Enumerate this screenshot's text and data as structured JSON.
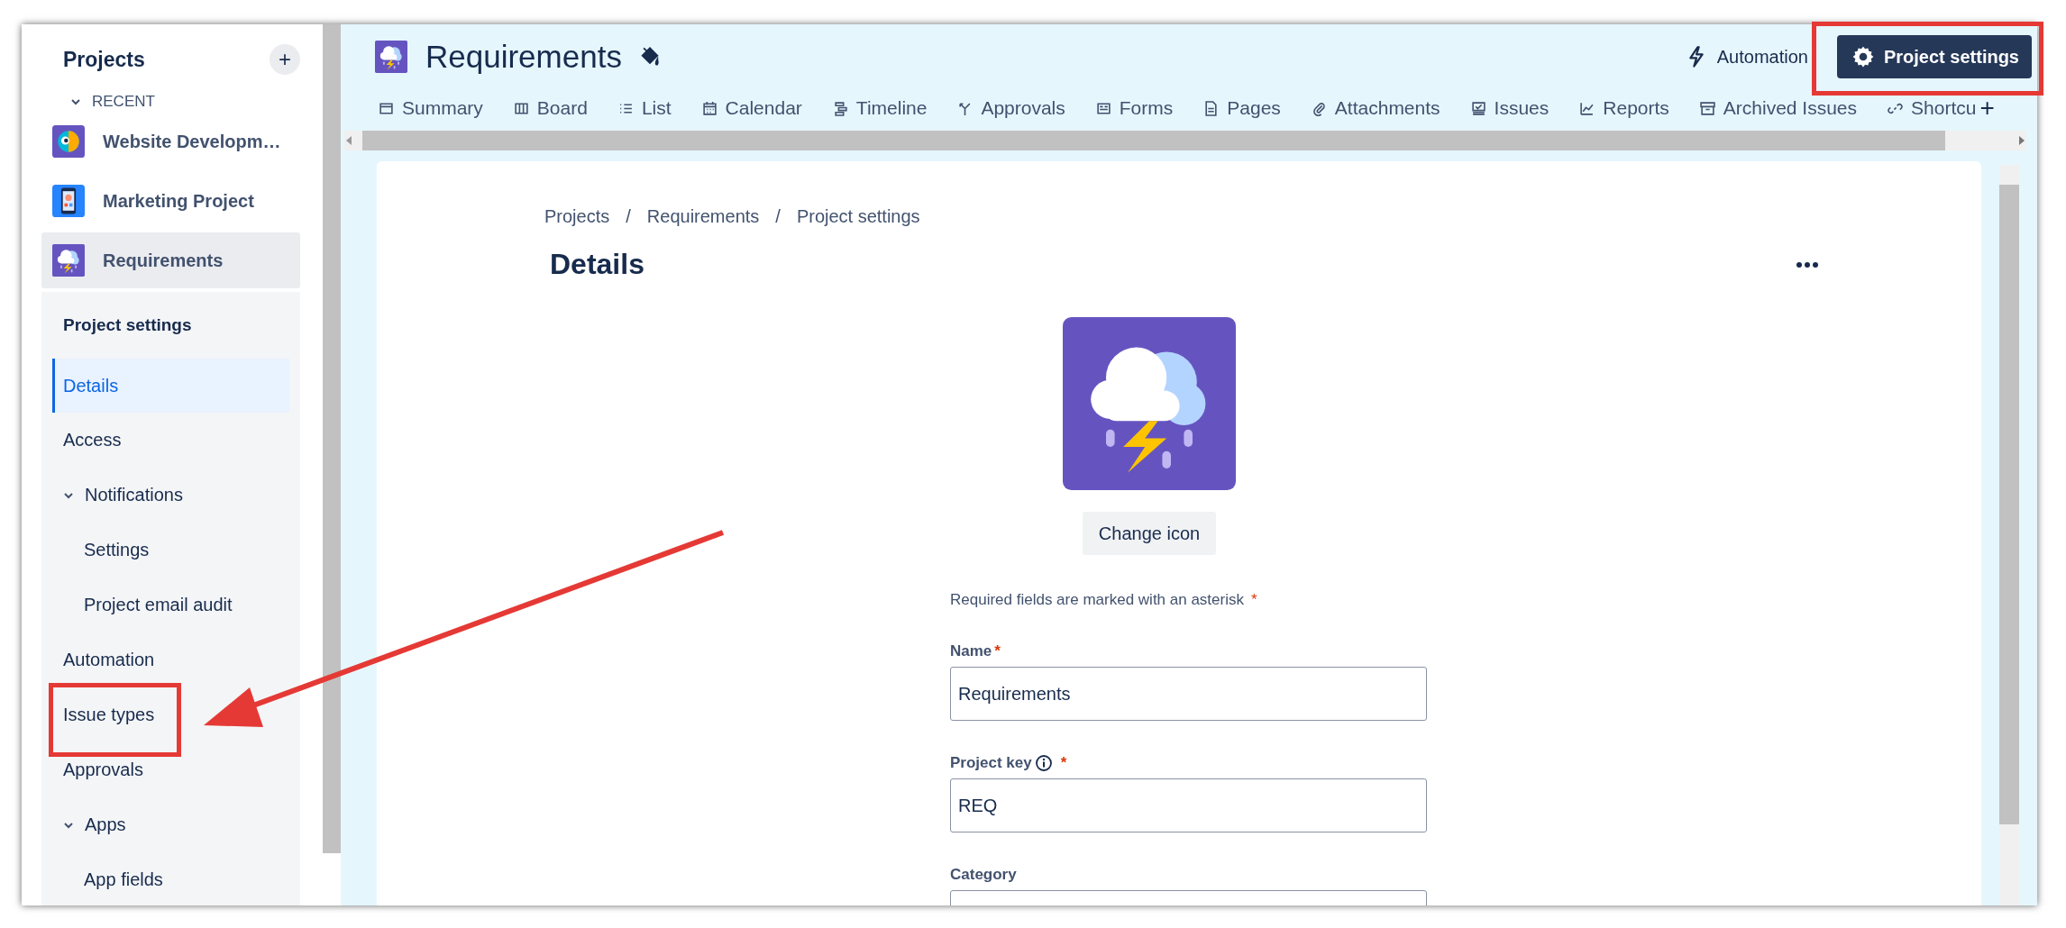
{
  "sidebar": {
    "title": "Projects",
    "add_button": "+",
    "section": "RECENT",
    "section_expanded": true,
    "projects": [
      {
        "name": "Website Developm…",
        "kind": "bird",
        "selected": false
      },
      {
        "name": "Marketing Project",
        "kind": "phone",
        "selected": false
      },
      {
        "name": "Requirements",
        "kind": "storm",
        "selected": true
      }
    ],
    "settings_title": "Project settings",
    "items": [
      {
        "label": "Details",
        "selected": true
      },
      {
        "label": "Access",
        "selected": false
      },
      {
        "label": "Notifications",
        "selected": false,
        "expanded": true,
        "children": [
          {
            "label": "Settings",
            "selected": false
          },
          {
            "label": "Project email audit",
            "selected": false
          }
        ]
      },
      {
        "label": "Automation",
        "selected": false
      },
      {
        "label": "Issue types",
        "selected": false
      },
      {
        "label": "Approvals",
        "selected": false
      },
      {
        "label": "Apps",
        "selected": false,
        "expanded": true,
        "children": [
          {
            "label": "App fields",
            "selected": false
          }
        ]
      }
    ]
  },
  "header": {
    "title": "Requirements",
    "automation": "Automation",
    "settings_button": "Project settings",
    "tabs": [
      {
        "label": "Summary",
        "kind": "summary"
      },
      {
        "label": "Board",
        "kind": "board"
      },
      {
        "label": "List",
        "kind": "list"
      },
      {
        "label": "Calendar",
        "kind": "calendar"
      },
      {
        "label": "Timeline",
        "kind": "timeline"
      },
      {
        "label": "Approvals",
        "kind": "approvals"
      },
      {
        "label": "Forms",
        "kind": "forms"
      },
      {
        "label": "Pages",
        "kind": "pages"
      },
      {
        "label": "Attachments",
        "kind": "attachments"
      },
      {
        "label": "Issues",
        "kind": "issues"
      },
      {
        "label": "Reports",
        "kind": "reports"
      },
      {
        "label": "Archived Issues",
        "kind": "archive"
      },
      {
        "label": "Shortcu",
        "kind": "link"
      }
    ],
    "add_tab": "+"
  },
  "content": {
    "breadcrumbs": [
      "Projects",
      "Requirements",
      "Project settings"
    ],
    "separator": "/",
    "heading": "Details",
    "change_icon_button": "Change icon",
    "required_note": {
      "text": "Required fields are marked with an asterisk",
      "mark": "*"
    },
    "fields": [
      {
        "label": "Name",
        "info": false,
        "required_mark": "*",
        "value": "Requirements"
      },
      {
        "label": "Project key",
        "info": true,
        "required_mark": "*",
        "value": "REQ"
      },
      {
        "label": "Category",
        "info": false
      }
    ]
  }
}
